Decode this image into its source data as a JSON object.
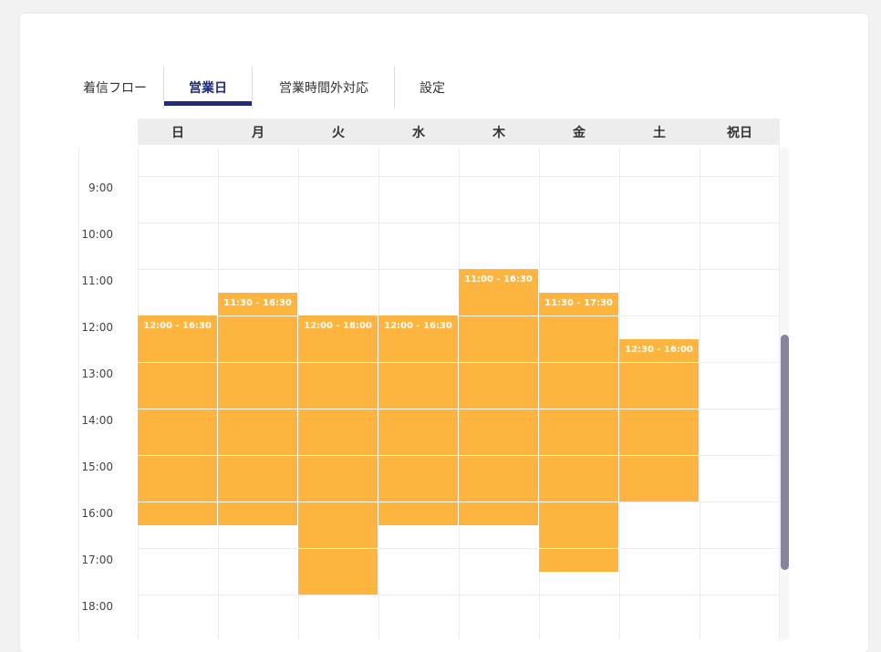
{
  "tabs": [
    {
      "label": "着信フロー",
      "active": false
    },
    {
      "label": "営業日",
      "active": true
    },
    {
      "label": "営業時間外対応",
      "active": false
    },
    {
      "label": "設定",
      "active": false
    }
  ],
  "days": [
    "日",
    "月",
    "火",
    "水",
    "木",
    "金",
    "土",
    "祝日"
  ],
  "times": [
    "9:00",
    "10:00",
    "11:00",
    "12:00",
    "13:00",
    "14:00",
    "15:00",
    "16:00",
    "17:00",
    "18:00"
  ],
  "schedule": [
    {
      "day": 0,
      "start": 12.0,
      "end": 16.5,
      "label": "12:00 - 16:30"
    },
    {
      "day": 1,
      "start": 11.5,
      "end": 16.5,
      "label": "11:30 - 16:30"
    },
    {
      "day": 2,
      "start": 12.0,
      "end": 18.0,
      "label": "12:00 - 18:00"
    },
    {
      "day": 3,
      "start": 12.0,
      "end": 16.5,
      "label": "12:00 - 16:30"
    },
    {
      "day": 4,
      "start": 11.0,
      "end": 16.5,
      "label": "11:00 - 16:30"
    },
    {
      "day": 5,
      "start": 11.5,
      "end": 17.5,
      "label": "11:30 - 17:30"
    },
    {
      "day": 6,
      "start": 12.5,
      "end": 16.0,
      "label": "12:30 - 16:00"
    }
  ],
  "colors": {
    "accent": "#1f2a7c",
    "block": "#fdb53f",
    "scroll_thumb": "#868599"
  }
}
